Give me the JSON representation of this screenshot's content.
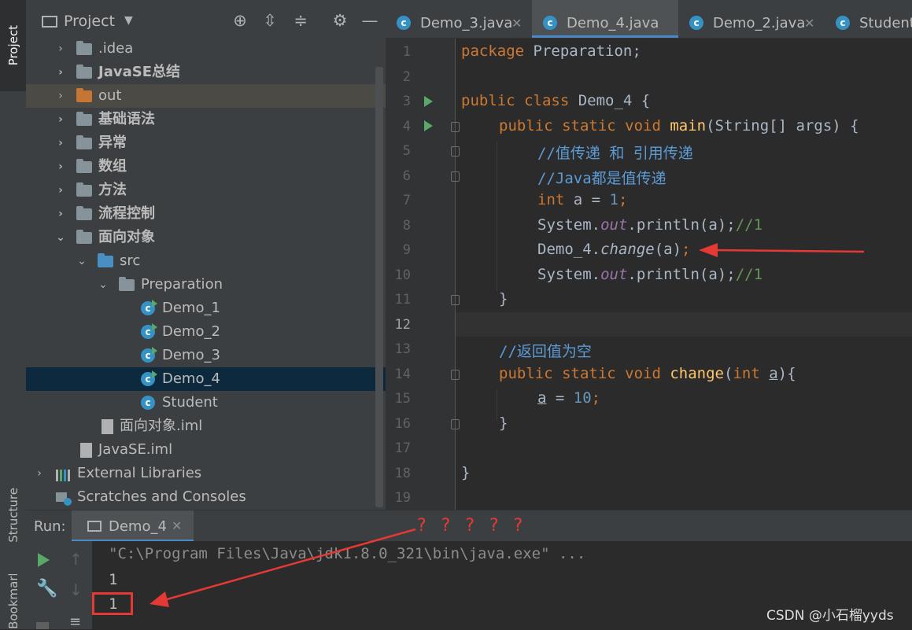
{
  "left_strip": {
    "project_tab": "Project",
    "structure_tab": "Structure",
    "bookmarks_tab": "Bookmarks"
  },
  "project_panel": {
    "title": "Project",
    "tree": [
      {
        "label": ".idea",
        "bold": false
      },
      {
        "label": "JavaSE总结",
        "bold": true
      },
      {
        "label": "out",
        "bold": false
      },
      {
        "label": "基础语法",
        "bold": true
      },
      {
        "label": "异常",
        "bold": true
      },
      {
        "label": "数组",
        "bold": true
      },
      {
        "label": "方法",
        "bold": true
      },
      {
        "label": "流程控制",
        "bold": true
      },
      {
        "label": "面向对象",
        "bold": true
      },
      {
        "label": "src",
        "bold": false
      },
      {
        "label": "Preparation",
        "bold": false
      },
      {
        "label": "Demo_1",
        "bold": false
      },
      {
        "label": "Demo_2",
        "bold": false
      },
      {
        "label": "Demo_3",
        "bold": false
      },
      {
        "label": "Demo_4",
        "bold": false
      },
      {
        "label": "Student",
        "bold": false
      },
      {
        "label": "面向对象.iml",
        "bold": false
      },
      {
        "label": "JavaSE.iml",
        "bold": false
      },
      {
        "label": "External Libraries",
        "bold": false
      },
      {
        "label": "Scratches and Consoles",
        "bold": false
      }
    ]
  },
  "editor_tabs": [
    {
      "label": "Demo_3.java",
      "active": false
    },
    {
      "label": "Demo_4.java",
      "active": true
    },
    {
      "label": "Demo_2.java",
      "active": false
    },
    {
      "label": "Student.",
      "active": false
    }
  ],
  "code": {
    "line_numbers": [
      "1",
      "2",
      "3",
      "4",
      "5",
      "6",
      "7",
      "8",
      "9",
      "10",
      "11",
      "12",
      "13",
      "14",
      "15",
      "16",
      "17",
      "18",
      "19"
    ],
    "l1_kw": "package",
    "l1_rest": " Preparation;",
    "l3_kw": "public class",
    "l3_rest": " Demo_4 {",
    "l4_kw": "public static void",
    "l4_fn": " main",
    "l4_rest": "(String[] args) {",
    "l5": "//值传递 和 引用传递",
    "l6": "//Java都是值传递",
    "l7_kw": "int",
    "l7_a": " a = ",
    "l7_num": "1",
    "l7_semi": ";",
    "l8_a": "System.",
    "l8_out": "out",
    "l8_b": ".println(a);",
    "l8_cm": "//1",
    "l9_a": "Demo_4.",
    "l9_fn": "change",
    "l9_b": "(a)",
    "l9_semi": ";",
    "l10_a": "System.",
    "l10_out": "out",
    "l10_b": ".println(a);",
    "l10_cm": "//1",
    "l11": "}",
    "l13": "//返回值为空",
    "l14_kw": "public static void",
    "l14_fn": " change",
    "l14_p": "(",
    "l14_int": "int",
    "l14_sp": " ",
    "l14_a": "a",
    "l14_end": "){",
    "l15_a": "a",
    "l15_eq": " = ",
    "l15_num": "10",
    "l15_semi": ";",
    "l16": "}",
    "l18": "}"
  },
  "run_panel": {
    "label": "Run:",
    "tab": "Demo_4",
    "console": [
      "\"C:\\Program Files\\Java\\jdk1.8.0_321\\bin\\java.exe\" ...",
      "1",
      "1"
    ]
  },
  "annotation": {
    "question_marks": "? ? ? ? ?",
    "color": "#e53935"
  },
  "watermark": "CSDN @小石榴yyds"
}
